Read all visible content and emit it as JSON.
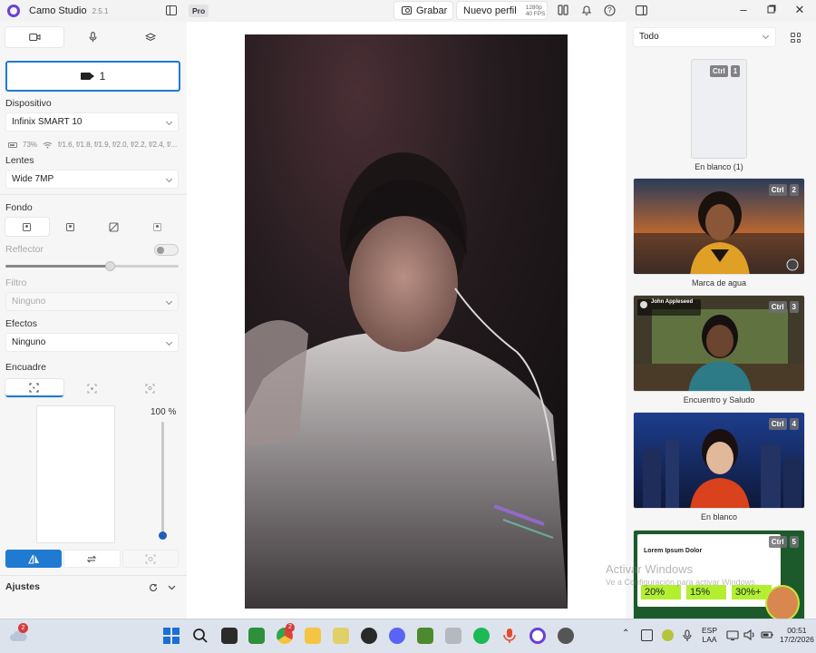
{
  "titlebar": {
    "app_name": "Camo Studio",
    "version": "2.5.1",
    "pro_badge": "Pro",
    "record_label": "Grabar",
    "profile_label": "Nuevo perfil",
    "resolution": "1280p",
    "fps": "40 FPS"
  },
  "left": {
    "camera_source": "1",
    "device_label": "Dispositivo",
    "device_value": "Infinix SMART 10",
    "battery": "73%",
    "apertures": "f/1.6, f/1.8, f/1.9, f/2.0, f/2.2, f/2.4, f/...",
    "lens_label": "Lentes",
    "lens_value": "Wide 7MP",
    "background_label": "Fondo",
    "reflector_label": "Reflector",
    "reflector_level": 0.6,
    "filter_label": "Filtro",
    "filter_value": "Ninguno",
    "effects_label": "Efectos",
    "effects_value": "Ninguno",
    "framing_label": "Encuadre",
    "zoom_value": "100 %",
    "settings_label": "Ajustes"
  },
  "right": {
    "filter_value": "Todo",
    "scenes": [
      {
        "label": "En blanco (1)",
        "ctrl": "Ctrl",
        "num": "1"
      },
      {
        "label": "Marca de agua",
        "ctrl": "Ctrl",
        "num": "2"
      },
      {
        "label": "Encuentro y Saludo",
        "ctrl": "Ctrl",
        "num": "3",
        "overlay_name": "John Appleseed"
      },
      {
        "label": "En blanco",
        "ctrl": "Ctrl",
        "num": "4"
      },
      {
        "label": "",
        "ctrl": "Ctrl",
        "num": "5",
        "overlay_title": "Lorem Ipsum Dolor",
        "stats": [
          "20%",
          "15%",
          "30%+"
        ]
      }
    ]
  },
  "watermark": {
    "title": "Activar Windows",
    "subtitle": "Ve a Configuración para activar Windows."
  },
  "taskbar": {
    "weather_badge": "2",
    "chrome_badge": "2",
    "lang_top": "ESP",
    "lang_bottom": "LAA",
    "time": "00:51",
    "date": "17/2/2026"
  },
  "colors": {
    "accent": "#1f7ad1",
    "brand": "#6b3fd6",
    "lime": "#b4ef2f"
  }
}
